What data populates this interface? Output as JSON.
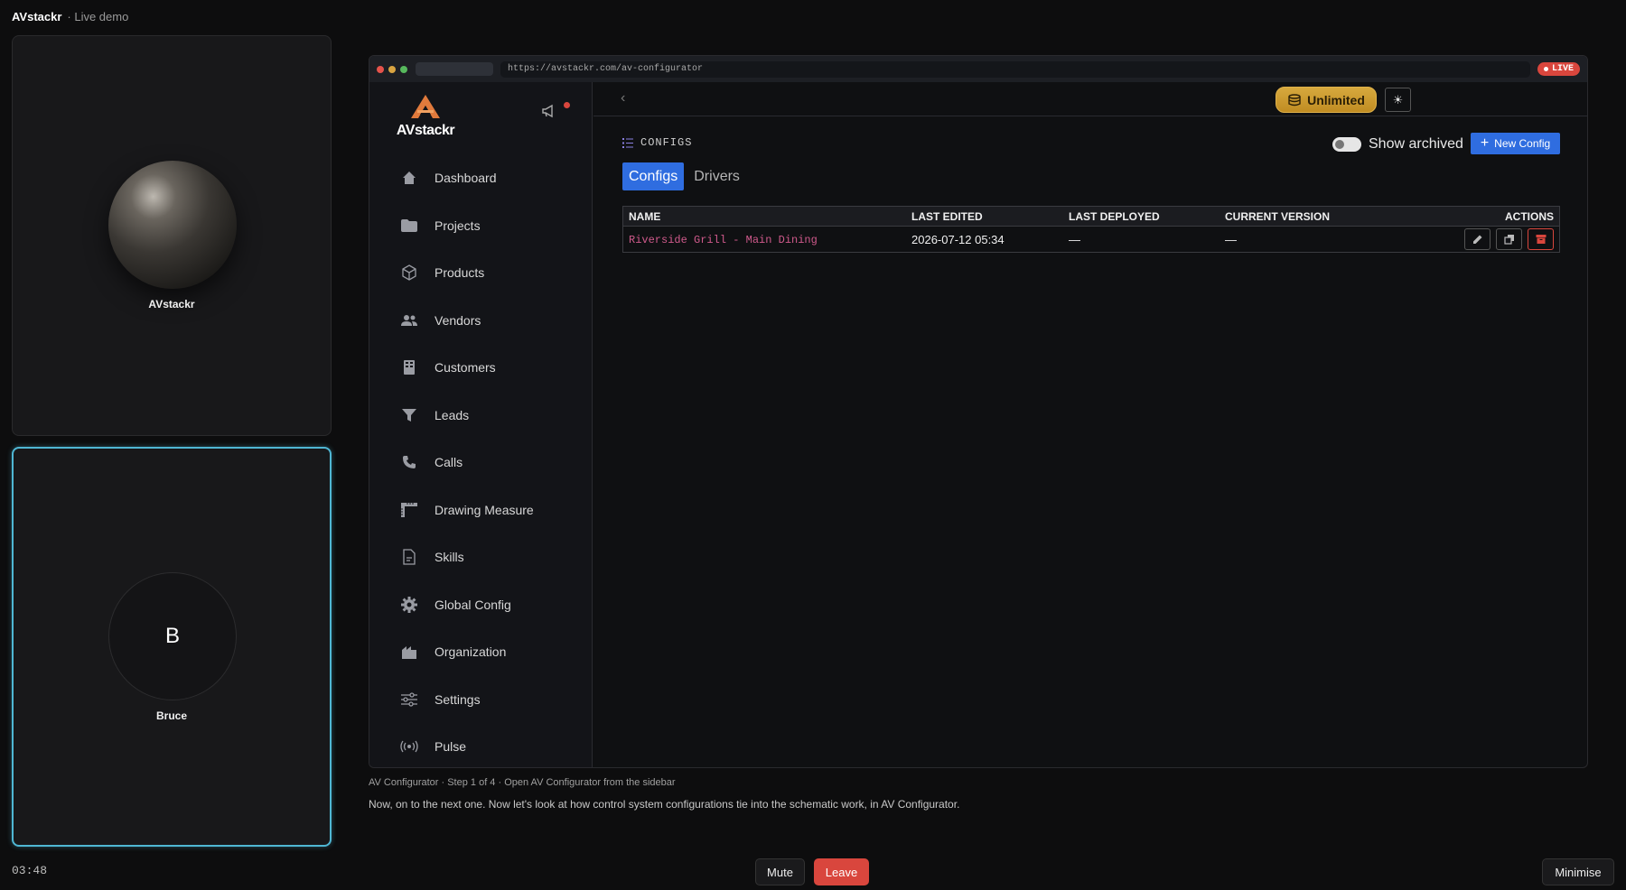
{
  "app": {
    "brand": "AVstackr",
    "subtitle": "· Live demo"
  },
  "participants": [
    {
      "name": "AVstackr"
    },
    {
      "name": "Bruce",
      "initial": "B"
    }
  ],
  "timer": "03:48",
  "browser": {
    "url": "https://avstackr.com/av-configurator",
    "live_label": "LIVE"
  },
  "sidebar": {
    "logo_text": "AVstackr",
    "items": [
      {
        "label": "Dashboard",
        "icon": "home-icon"
      },
      {
        "label": "Projects",
        "icon": "folder-icon"
      },
      {
        "label": "Products",
        "icon": "box-icon"
      },
      {
        "label": "Vendors",
        "icon": "users-icon"
      },
      {
        "label": "Customers",
        "icon": "building-icon"
      },
      {
        "label": "Leads",
        "icon": "funnel-icon"
      },
      {
        "label": "Calls",
        "icon": "phone-icon"
      },
      {
        "label": "Drawing Measure",
        "icon": "ruler-icon"
      },
      {
        "label": "Skills",
        "icon": "document-icon"
      },
      {
        "label": "Global Config",
        "icon": "gear-icon"
      },
      {
        "label": "Organization",
        "icon": "org-icon"
      },
      {
        "label": "Settings",
        "icon": "sliders-icon"
      },
      {
        "label": "Pulse",
        "icon": "broadcast-icon"
      }
    ]
  },
  "header": {
    "plan_badge": "Unlimited"
  },
  "configs": {
    "section_title": "CONFIGS",
    "show_archived_label": "Show archived",
    "new_button": "New Config",
    "tabs": [
      {
        "label": "Configs",
        "active": true
      },
      {
        "label": "Drivers",
        "active": false
      }
    ],
    "columns": {
      "name": "NAME",
      "last_edited": "LAST EDITED",
      "last_deployed": "LAST DEPLOYED",
      "current_version": "CURRENT VERSION",
      "actions": "ACTIONS"
    },
    "rows": [
      {
        "name": "Riverside Grill - Main Dining",
        "last_edited": "2026-07-12 05:34",
        "last_deployed": "—",
        "current_version": "—"
      }
    ]
  },
  "walkthrough": {
    "step": "AV Configurator · Step 1 of 4 · Open AV Configurator from the sidebar",
    "caption": "Now, on to the next one. Now let's look at how control system configurations tie into the schematic work, in AV Configurator."
  },
  "controls": {
    "mute": "Mute",
    "leave": "Leave",
    "minimise": "Minimise"
  },
  "colors": {
    "accent": "#2f6de0",
    "live": "#d9463d",
    "plan": "#c99a2e",
    "tile_highlight": "#4fb6d3"
  }
}
